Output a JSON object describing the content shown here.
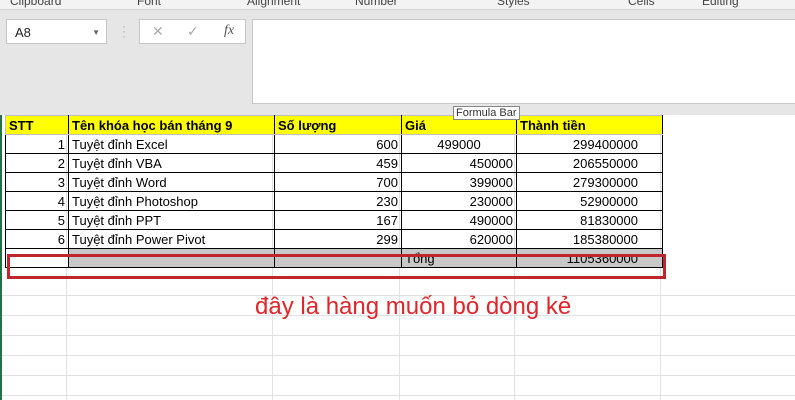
{
  "ribbon": {
    "groups": [
      "Clipboard",
      "Font",
      "Alignment",
      "Number",
      "Styles",
      "Cells",
      "Editing"
    ]
  },
  "formula_bar": {
    "name_box": "A8",
    "cancel_icon": "✕",
    "enter_icon": "✓",
    "fx_icon": "fx",
    "value": "",
    "tooltip": "Formula Bar"
  },
  "table": {
    "headers": [
      "STT",
      "Tên khóa học bán tháng 9",
      "Số lượng",
      "Giá",
      "Thành tiền"
    ],
    "rows": [
      [
        "1",
        "Tuyệt đỉnh Excel",
        "600",
        "499000",
        "299400000"
      ],
      [
        "2",
        "Tuyệt đỉnh VBA",
        "459",
        "450000",
        "206550000"
      ],
      [
        "3",
        "Tuyệt đỉnh Word",
        "700",
        "399000",
        "279300000"
      ],
      [
        "4",
        "Tuyệt đỉnh Photoshop",
        "230",
        "230000",
        "52900000"
      ],
      [
        "5",
        "Tuyệt đỉnh PPT",
        "167",
        "490000",
        "81830000"
      ],
      [
        "6",
        "Tuyệt đỉnh Power Pivot",
        "299",
        "620000",
        "185380000"
      ]
    ],
    "total_label": "Tổng",
    "total_value": "1105360000"
  },
  "annotation": "đây là hàng muốn bỏ dòng kẻ",
  "colors": {
    "header_bg": "#ffff00",
    "highlight": "#c0272d",
    "annotation": "#e0262a"
  }
}
